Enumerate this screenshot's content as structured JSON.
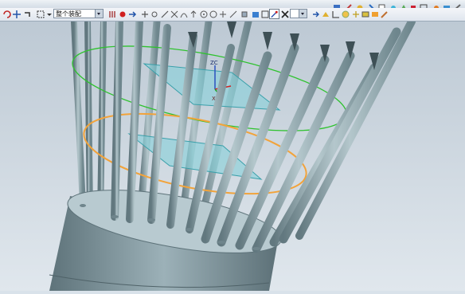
{
  "toolbar": {
    "filter_select": {
      "value": "整个装配"
    },
    "type_select": {
      "value": ""
    },
    "icons_top": [
      "part-icon",
      "sketch-icon",
      "view-icon",
      "render-icon",
      "shade-icon",
      "analysis-icon",
      "orient-icon",
      "snap-icon",
      "grid-icon",
      "wcs-icon",
      "layer-icon",
      "edit-icon"
    ],
    "icons_main": [
      "rotate-icon",
      "pan-icon",
      "undo-icon",
      "select-icon",
      "filter-icon",
      "point-icon",
      "line-icon",
      "arc-icon",
      "circle-icon",
      "grid-point-icon",
      "snap-icon",
      "intersection-icon",
      "end-point-icon",
      "mid-point-icon",
      "center-icon",
      "quadrant-icon",
      "tangent-icon",
      "face-icon",
      "body-icon",
      "cancel-icon",
      "wcs-icon"
    ]
  },
  "viewport": {
    "wcs_labels": {
      "z": "ZC",
      "x": "XC"
    },
    "colors": {
      "background_top": "#bfcbd6",
      "background_bottom": "#dde5ec",
      "rod": "#8fa6ae",
      "plane": "#7fd0d8",
      "green_circle": "#2ec22e",
      "orange_circle": "#f2a33a",
      "base": "#8aa0a8"
    }
  }
}
